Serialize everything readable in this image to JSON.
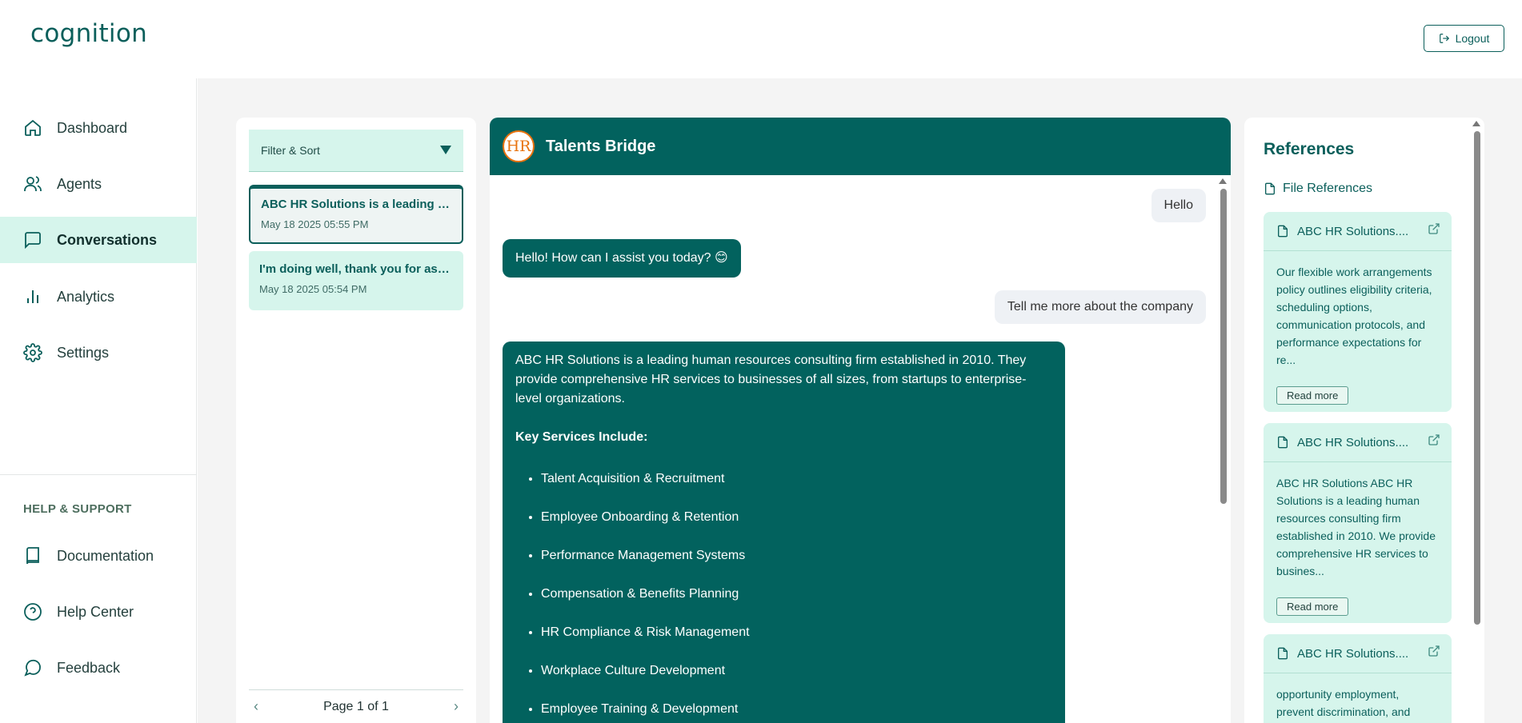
{
  "app": {
    "logo": "cognition",
    "logout_label": "Logout"
  },
  "sidebar": {
    "items": [
      {
        "label": "Dashboard",
        "icon": "home-icon"
      },
      {
        "label": "Agents",
        "icon": "users-icon"
      },
      {
        "label": "Conversations",
        "icon": "chat-icon",
        "active": true
      },
      {
        "label": "Analytics",
        "icon": "bar-chart-icon"
      },
      {
        "label": "Settings",
        "icon": "gear-icon"
      }
    ],
    "help_heading": "HELP & SUPPORT",
    "help_items": [
      {
        "label": "Documentation",
        "icon": "book-icon"
      },
      {
        "label": "Help Center",
        "icon": "help-circle-icon"
      },
      {
        "label": "Feedback",
        "icon": "message-circle-icon"
      }
    ]
  },
  "conversation_list": {
    "filter_label": "Filter & Sort",
    "items": [
      {
        "title": "ABC HR Solutions is a leading human resources consulting firm",
        "date": "May 18 2025 05:55 PM",
        "selected": true
      },
      {
        "title": "I'm doing well, thank you for asking",
        "date": "May 18 2025 05:54 PM",
        "selected": false
      }
    ],
    "pager_label": "Page 1 of 1"
  },
  "chat": {
    "agent_name": "Talents Bridge",
    "avatar_text": "HR",
    "messages": {
      "user_1": "Hello",
      "bot_1": "Hello! How can I assist you today? 😊",
      "user_2": "Tell me more about the company",
      "bot_2_intro": "ABC HR Solutions is a leading human resources consulting firm established in 2010. They provide comprehensive HR services to businesses of all sizes, from startups to enterprise-level organizations.",
      "bot_2_heading": "Key Services Include:",
      "bot_2_services": [
        "Talent Acquisition & Recruitment",
        "Employee Onboarding & Retention",
        "Performance Management Systems",
        "Compensation & Benefits Planning",
        "HR Compliance & Risk Management",
        "Workplace Culture Development",
        "Employee Training & Development"
      ]
    }
  },
  "references": {
    "title": "References",
    "file_refs_label": "File References",
    "read_more_label": "Read more",
    "cards": [
      {
        "name": "ABC HR Solutions....",
        "snippet": "Our flexible work arrangements policy outlines eligibility criteria, scheduling options, communication protocols, and performance expectations for re..."
      },
      {
        "name": "ABC HR Solutions....",
        "snippet": "ABC HR Solutions ABC HR Solutions is a leading human resources consulting firm established in 2010. We provide comprehensive HR services to busines..."
      },
      {
        "name": "ABC HR Solutions....",
        "snippet": "opportunity employment, prevent discrimination, and"
      }
    ]
  },
  "colors": {
    "brand": "#02625e",
    "accent_light": "#d6f5ec",
    "hr_logo_orange": "#e8730f"
  }
}
